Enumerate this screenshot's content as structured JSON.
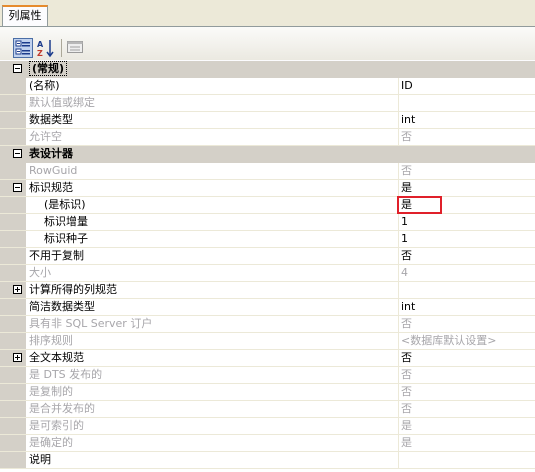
{
  "tab": {
    "label": "列属性"
  },
  "toolbar": {
    "icons": [
      "categorized-icon",
      "alphabetical-sort-icon",
      "property-pages-icon"
    ]
  },
  "rows": [
    {
      "name": "(常规)",
      "value": "",
      "category": true,
      "expander": "minus"
    },
    {
      "name": "(名称)",
      "value": "ID"
    },
    {
      "name": "默认值或绑定",
      "value": "",
      "disabled": true
    },
    {
      "name": "数据类型",
      "value": "int"
    },
    {
      "name": "允许空",
      "value": "否",
      "disabled": true
    },
    {
      "name": "表设计器",
      "value": "",
      "category": true,
      "expander": "minus"
    },
    {
      "name": "RowGuid",
      "value": "否",
      "disabled": true
    },
    {
      "name": "标识规范",
      "value": "是",
      "expander": "minus"
    },
    {
      "name": "(是标识)",
      "value": "是",
      "indent": true
    },
    {
      "name": "标识增量",
      "value": "1",
      "indent": true
    },
    {
      "name": "标识种子",
      "value": "1",
      "indent": true
    },
    {
      "name": "不用于复制",
      "value": "否"
    },
    {
      "name": "大小",
      "value": "4",
      "disabled": true
    },
    {
      "name": "计算所得的列规范",
      "value": "",
      "expander": "plus"
    },
    {
      "name": "简洁数据类型",
      "value": "int"
    },
    {
      "name": "具有非 SQL Server 订户",
      "value": "否",
      "disabled": true
    },
    {
      "name": "排序规则",
      "value": "<数据库默认设置>",
      "disabled": true
    },
    {
      "name": "全文本规范",
      "value": "否",
      "expander": "plus"
    },
    {
      "name": "是 DTS 发布的",
      "value": "否",
      "disabled": true
    },
    {
      "name": "是复制的",
      "value": "否",
      "disabled": true
    },
    {
      "name": "是合并发布的",
      "value": "否",
      "disabled": true
    },
    {
      "name": "是可索引的",
      "value": "是",
      "disabled": true
    },
    {
      "name": "是确定的",
      "value": "是",
      "disabled": true
    },
    {
      "name": "说明",
      "value": ""
    }
  ],
  "colors": {
    "disabled_text": "#a7a6aa",
    "highlight_box": "#e0202a",
    "category_bg": "#d4d0c8"
  }
}
